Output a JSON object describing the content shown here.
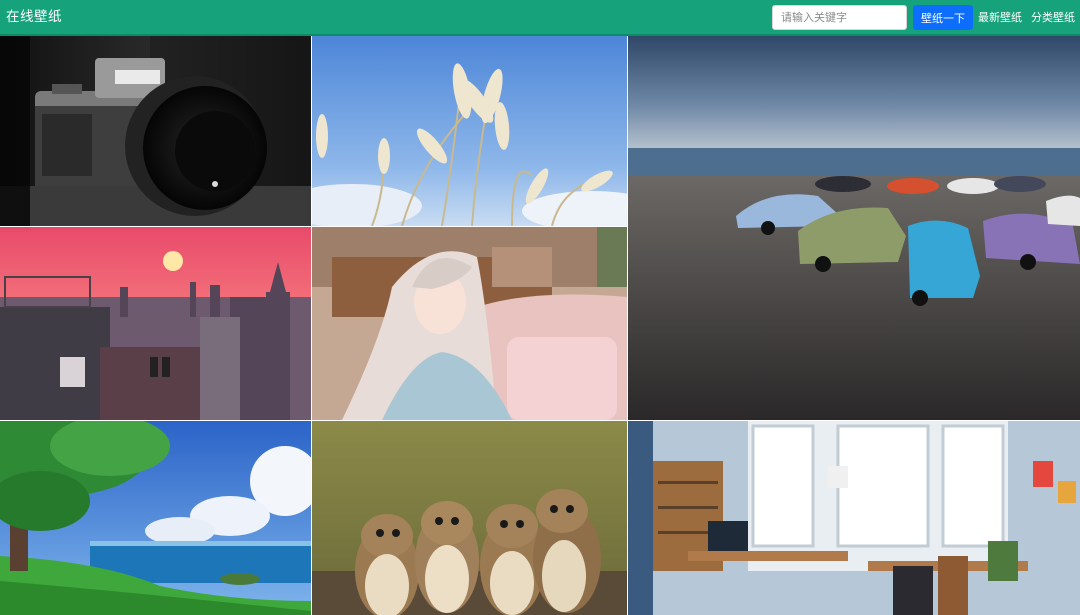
{
  "header": {
    "brand": "在线壁纸",
    "search_placeholder": "请输入关键字",
    "search_button": "壁纸一下",
    "nav_latest": "最新壁纸",
    "nav_category": "分类壁纸"
  },
  "colors": {
    "navbar": "#16a37c",
    "search_button": "#0d6efd"
  },
  "wallpapers": [
    {
      "subject": "camera-photo"
    },
    {
      "subject": "reeds-sky-photo"
    },
    {
      "subject": "cars-beach-photo"
    },
    {
      "subject": "city-sunset-photo"
    },
    {
      "subject": "anime-girl-photo"
    },
    {
      "subject": "anime-tree-seaside-photo"
    },
    {
      "subject": "owls-photo"
    },
    {
      "subject": "room-interior-photo"
    }
  ]
}
